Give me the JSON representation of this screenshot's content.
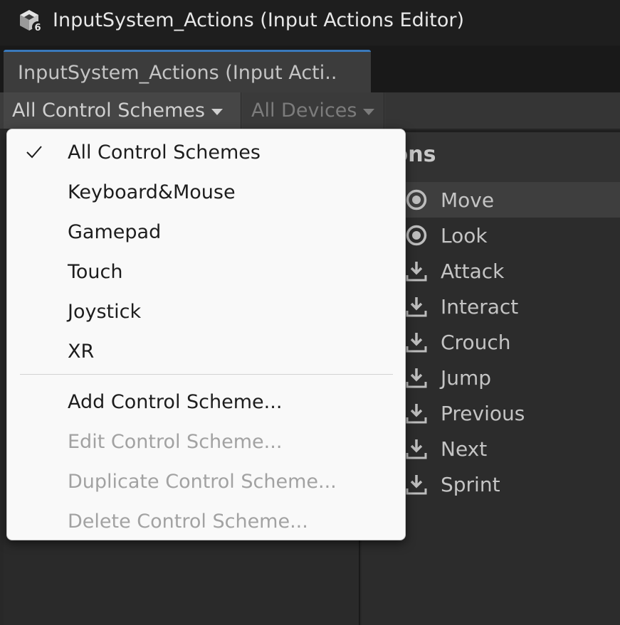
{
  "window": {
    "title": "InputSystem_Actions (Input Actions Editor)",
    "icon": "unity-cube-icon"
  },
  "tabs": [
    {
      "label": "InputSystem_Actions (Input Acti.."
    }
  ],
  "toolbar": {
    "control_schemes_label": "All Control Schemes",
    "devices_label": "All Devices"
  },
  "actions_panel": {
    "title": "tions",
    "items": [
      {
        "label": "Move",
        "icon": "value-action-icon",
        "selected": true
      },
      {
        "label": "Look",
        "icon": "value-action-icon"
      },
      {
        "label": "Attack",
        "icon": "button-action-icon"
      },
      {
        "label": "Interact",
        "icon": "button-action-icon"
      },
      {
        "label": "Crouch",
        "icon": "button-action-icon"
      },
      {
        "label": "Jump",
        "icon": "button-action-icon"
      },
      {
        "label": "Previous",
        "icon": "button-action-icon"
      },
      {
        "label": "Next",
        "icon": "button-action-icon"
      },
      {
        "label": "Sprint",
        "icon": "button-action-icon"
      }
    ]
  },
  "dropdown_menu": {
    "items": [
      {
        "label": "All Control Schemes",
        "checked": true
      },
      {
        "label": "Keyboard&Mouse"
      },
      {
        "label": "Gamepad"
      },
      {
        "label": "Touch"
      },
      {
        "label": "Joystick"
      },
      {
        "label": "XR"
      },
      {
        "label": "Add Control Scheme..."
      },
      {
        "label": "Edit Control Scheme...",
        "disabled": true
      },
      {
        "label": "Duplicate Control Scheme...",
        "disabled": true
      },
      {
        "label": "Delete Control Scheme...",
        "disabled": true
      }
    ]
  },
  "colors": {
    "accent": "#3a79bb",
    "menu_background": "#f9f9f9",
    "editor_background": "#282828"
  }
}
